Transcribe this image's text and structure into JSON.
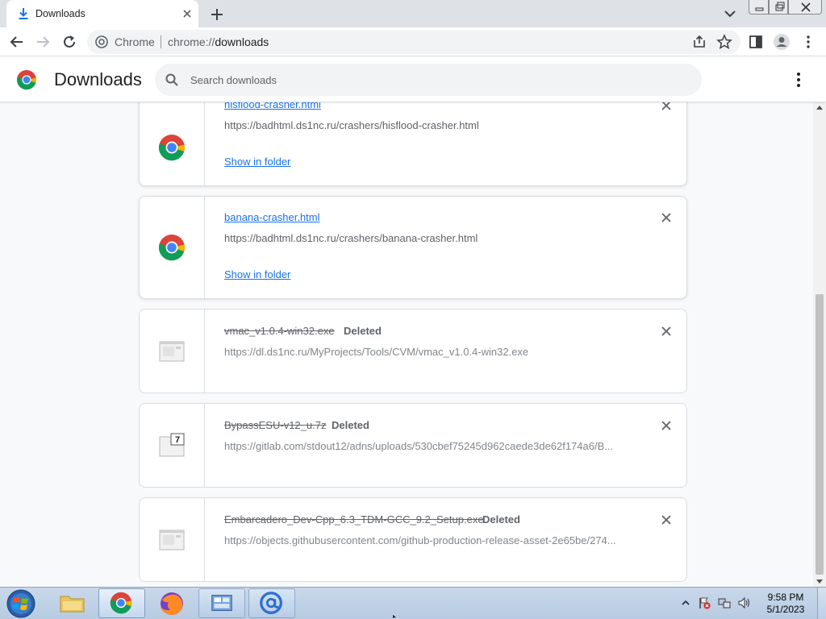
{
  "tab": {
    "title": "Downloads",
    "close_label": "×",
    "new_tab_label": "+"
  },
  "omnibox": {
    "site_label": "Chrome",
    "url_scheme": "chrome://",
    "url_path": "downloads"
  },
  "page": {
    "title": "Downloads",
    "search_placeholder": "Search downloads"
  },
  "downloads": [
    {
      "name": "hisflood-crasher.html",
      "url": "https://badhtml.ds1nc.ru/crashers/hisflood-crasher.html",
      "action": "Show in folder",
      "status": "",
      "deleted": false,
      "icon": "chrome-icon"
    },
    {
      "name": "banana-crasher.html",
      "url": "https://badhtml.ds1nc.ru/crashers/banana-crasher.html",
      "action": "Show in folder",
      "status": "",
      "deleted": false,
      "icon": "chrome-icon"
    },
    {
      "name": "vmac_v1.0.4-win32.exe",
      "url": "https://dl.ds1nc.ru/MyProjects/Tools/CVM/vmac_v1.0.4-win32.exe",
      "action": "",
      "status": "Deleted",
      "deleted": true,
      "icon": "exe-file-icon"
    },
    {
      "name": "BypassESU-v12_u.7z",
      "url": "https://gitlab.com/stdout12/adns/uploads/530cbef75245d962caede3de62f174a6/B...",
      "action": "",
      "status": "Deleted",
      "deleted": true,
      "icon": "7z-file-icon"
    },
    {
      "name": "Embarcadero_Dev-Cpp_6.3_TDM-GCC_9.2_Setup.exe",
      "url": "https://objects.githubusercontent.com/github-production-release-asset-2e65be/274...",
      "action": "",
      "status": "Deleted",
      "deleted": true,
      "icon": "exe-file-icon"
    }
  ],
  "taskbar": {
    "apps": [
      "windows-explorer",
      "google-chrome",
      "firefox",
      "control-panel",
      "mail-client"
    ],
    "clock_time": "9:58 PM",
    "clock_date": "5/1/2023"
  },
  "colors": {
    "accent": "#1a73e8",
    "tabstrip": "#dee1e6",
    "taskbar": "#c9d8ea"
  }
}
